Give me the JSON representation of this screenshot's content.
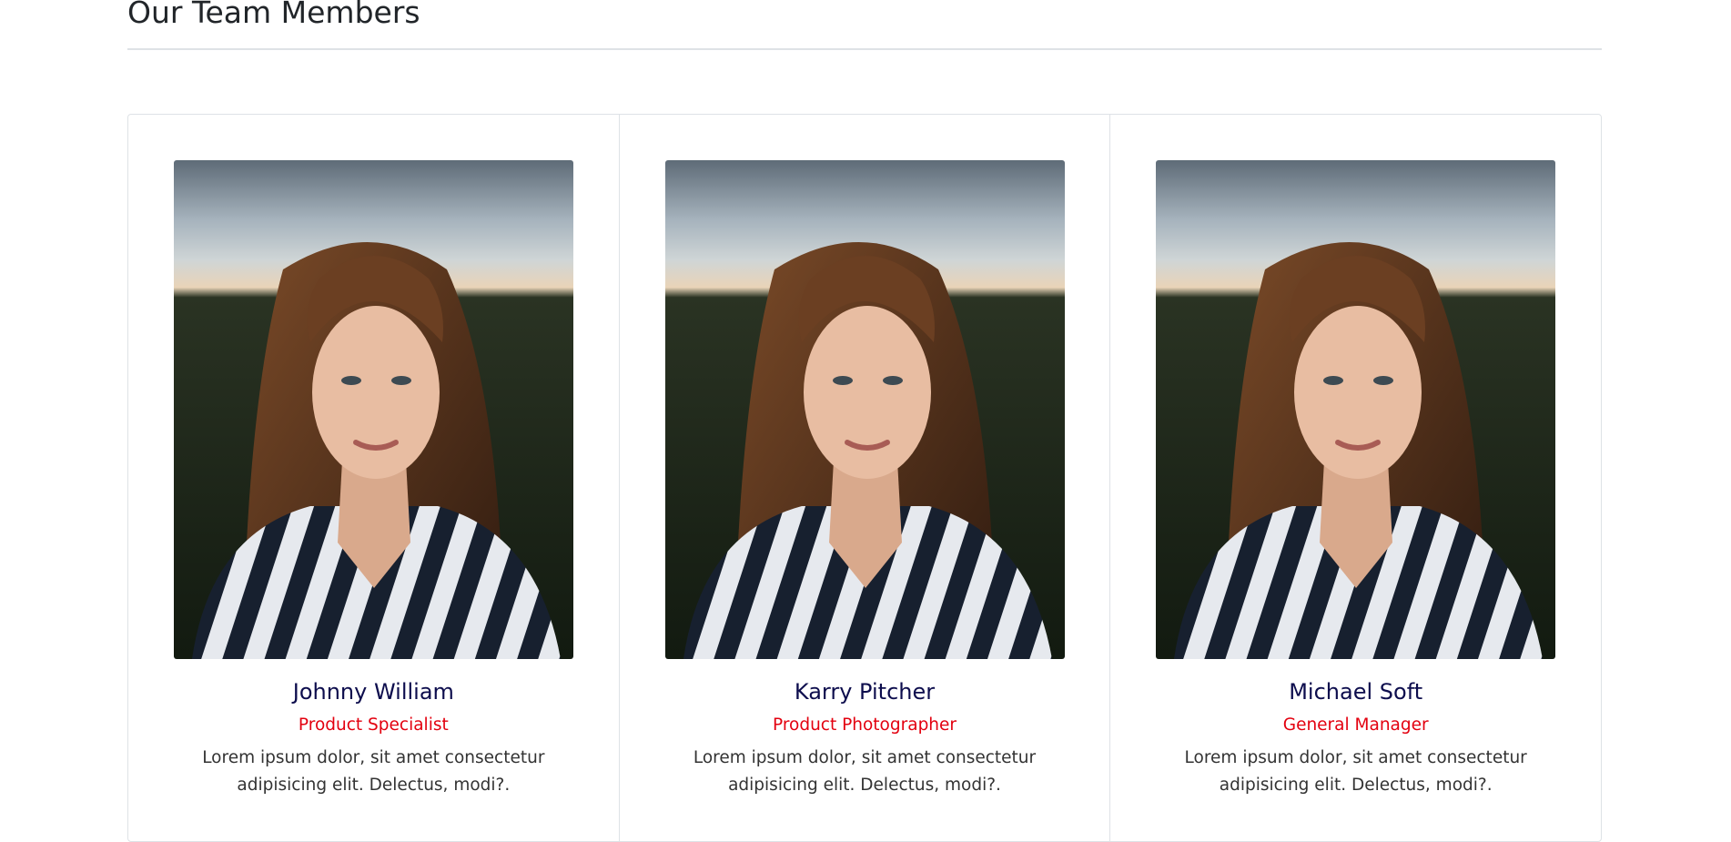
{
  "page": {
    "title": "Our Team Members"
  },
  "colors": {
    "name": "#0d0d4d",
    "role": "#e3000f",
    "text": "#333333",
    "border": "#dee2e6"
  },
  "team": [
    {
      "name": "Johnny William",
      "role": "Product Specialist",
      "bio": "Lorem ipsum dolor, sit amet consectetur adipisicing elit. Delectus, modi?.",
      "photo_icon": "portrait-photo"
    },
    {
      "name": "Karry Pitcher",
      "role": "Product Photographer",
      "bio": "Lorem ipsum dolor, sit amet consectetur adipisicing elit. Delectus, modi?.",
      "photo_icon": "portrait-photo"
    },
    {
      "name": "Michael Soft",
      "role": "General Manager",
      "bio": "Lorem ipsum dolor, sit amet consectetur adipisicing elit. Delectus, modi?.",
      "photo_icon": "portrait-photo"
    }
  ]
}
